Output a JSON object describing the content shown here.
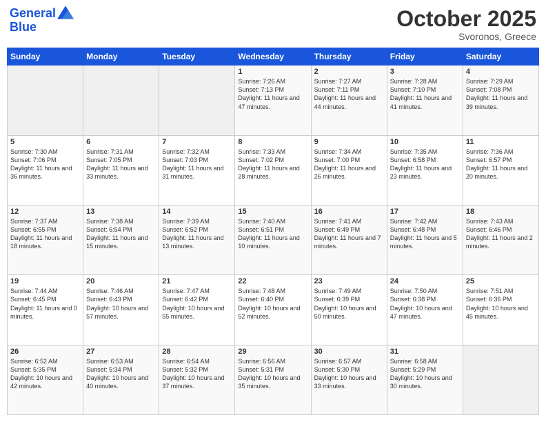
{
  "header": {
    "logo_line1": "General",
    "logo_line2": "Blue",
    "month": "October 2025",
    "location": "Svoronos, Greece"
  },
  "days_of_week": [
    "Sunday",
    "Monday",
    "Tuesday",
    "Wednesday",
    "Thursday",
    "Friday",
    "Saturday"
  ],
  "weeks": [
    [
      {
        "day": "",
        "content": ""
      },
      {
        "day": "",
        "content": ""
      },
      {
        "day": "",
        "content": ""
      },
      {
        "day": "1",
        "content": "Sunrise: 7:26 AM\nSunset: 7:13 PM\nDaylight: 11 hours\nand 47 minutes."
      },
      {
        "day": "2",
        "content": "Sunrise: 7:27 AM\nSunset: 7:11 PM\nDaylight: 11 hours\nand 44 minutes."
      },
      {
        "day": "3",
        "content": "Sunrise: 7:28 AM\nSunset: 7:10 PM\nDaylight: 11 hours\nand 41 minutes."
      },
      {
        "day": "4",
        "content": "Sunrise: 7:29 AM\nSunset: 7:08 PM\nDaylight: 11 hours\nand 39 minutes."
      }
    ],
    [
      {
        "day": "5",
        "content": "Sunrise: 7:30 AM\nSunset: 7:06 PM\nDaylight: 11 hours\nand 36 minutes."
      },
      {
        "day": "6",
        "content": "Sunrise: 7:31 AM\nSunset: 7:05 PM\nDaylight: 11 hours\nand 33 minutes."
      },
      {
        "day": "7",
        "content": "Sunrise: 7:32 AM\nSunset: 7:03 PM\nDaylight: 11 hours\nand 31 minutes."
      },
      {
        "day": "8",
        "content": "Sunrise: 7:33 AM\nSunset: 7:02 PM\nDaylight: 11 hours\nand 28 minutes."
      },
      {
        "day": "9",
        "content": "Sunrise: 7:34 AM\nSunset: 7:00 PM\nDaylight: 11 hours\nand 26 minutes."
      },
      {
        "day": "10",
        "content": "Sunrise: 7:35 AM\nSunset: 6:58 PM\nDaylight: 11 hours\nand 23 minutes."
      },
      {
        "day": "11",
        "content": "Sunrise: 7:36 AM\nSunset: 6:57 PM\nDaylight: 11 hours\nand 20 minutes."
      }
    ],
    [
      {
        "day": "12",
        "content": "Sunrise: 7:37 AM\nSunset: 6:55 PM\nDaylight: 11 hours\nand 18 minutes."
      },
      {
        "day": "13",
        "content": "Sunrise: 7:38 AM\nSunset: 6:54 PM\nDaylight: 11 hours\nand 15 minutes."
      },
      {
        "day": "14",
        "content": "Sunrise: 7:39 AM\nSunset: 6:52 PM\nDaylight: 11 hours\nand 13 minutes."
      },
      {
        "day": "15",
        "content": "Sunrise: 7:40 AM\nSunset: 6:51 PM\nDaylight: 11 hours\nand 10 minutes."
      },
      {
        "day": "16",
        "content": "Sunrise: 7:41 AM\nSunset: 6:49 PM\nDaylight: 11 hours\nand 7 minutes."
      },
      {
        "day": "17",
        "content": "Sunrise: 7:42 AM\nSunset: 6:48 PM\nDaylight: 11 hours\nand 5 minutes."
      },
      {
        "day": "18",
        "content": "Sunrise: 7:43 AM\nSunset: 6:46 PM\nDaylight: 11 hours\nand 2 minutes."
      }
    ],
    [
      {
        "day": "19",
        "content": "Sunrise: 7:44 AM\nSunset: 6:45 PM\nDaylight: 11 hours\nand 0 minutes."
      },
      {
        "day": "20",
        "content": "Sunrise: 7:46 AM\nSunset: 6:43 PM\nDaylight: 10 hours\nand 57 minutes."
      },
      {
        "day": "21",
        "content": "Sunrise: 7:47 AM\nSunset: 6:42 PM\nDaylight: 10 hours\nand 55 minutes."
      },
      {
        "day": "22",
        "content": "Sunrise: 7:48 AM\nSunset: 6:40 PM\nDaylight: 10 hours\nand 52 minutes."
      },
      {
        "day": "23",
        "content": "Sunrise: 7:49 AM\nSunset: 6:39 PM\nDaylight: 10 hours\nand 50 minutes."
      },
      {
        "day": "24",
        "content": "Sunrise: 7:50 AM\nSunset: 6:38 PM\nDaylight: 10 hours\nand 47 minutes."
      },
      {
        "day": "25",
        "content": "Sunrise: 7:51 AM\nSunset: 6:36 PM\nDaylight: 10 hours\nand 45 minutes."
      }
    ],
    [
      {
        "day": "26",
        "content": "Sunrise: 6:52 AM\nSunset: 5:35 PM\nDaylight: 10 hours\nand 42 minutes."
      },
      {
        "day": "27",
        "content": "Sunrise: 6:53 AM\nSunset: 5:34 PM\nDaylight: 10 hours\nand 40 minutes."
      },
      {
        "day": "28",
        "content": "Sunrise: 6:54 AM\nSunset: 5:32 PM\nDaylight: 10 hours\nand 37 minutes."
      },
      {
        "day": "29",
        "content": "Sunrise: 6:56 AM\nSunset: 5:31 PM\nDaylight: 10 hours\nand 35 minutes."
      },
      {
        "day": "30",
        "content": "Sunrise: 6:57 AM\nSunset: 5:30 PM\nDaylight: 10 hours\nand 33 minutes."
      },
      {
        "day": "31",
        "content": "Sunrise: 6:58 AM\nSunset: 5:29 PM\nDaylight: 10 hours\nand 30 minutes."
      },
      {
        "day": "",
        "content": ""
      }
    ]
  ]
}
